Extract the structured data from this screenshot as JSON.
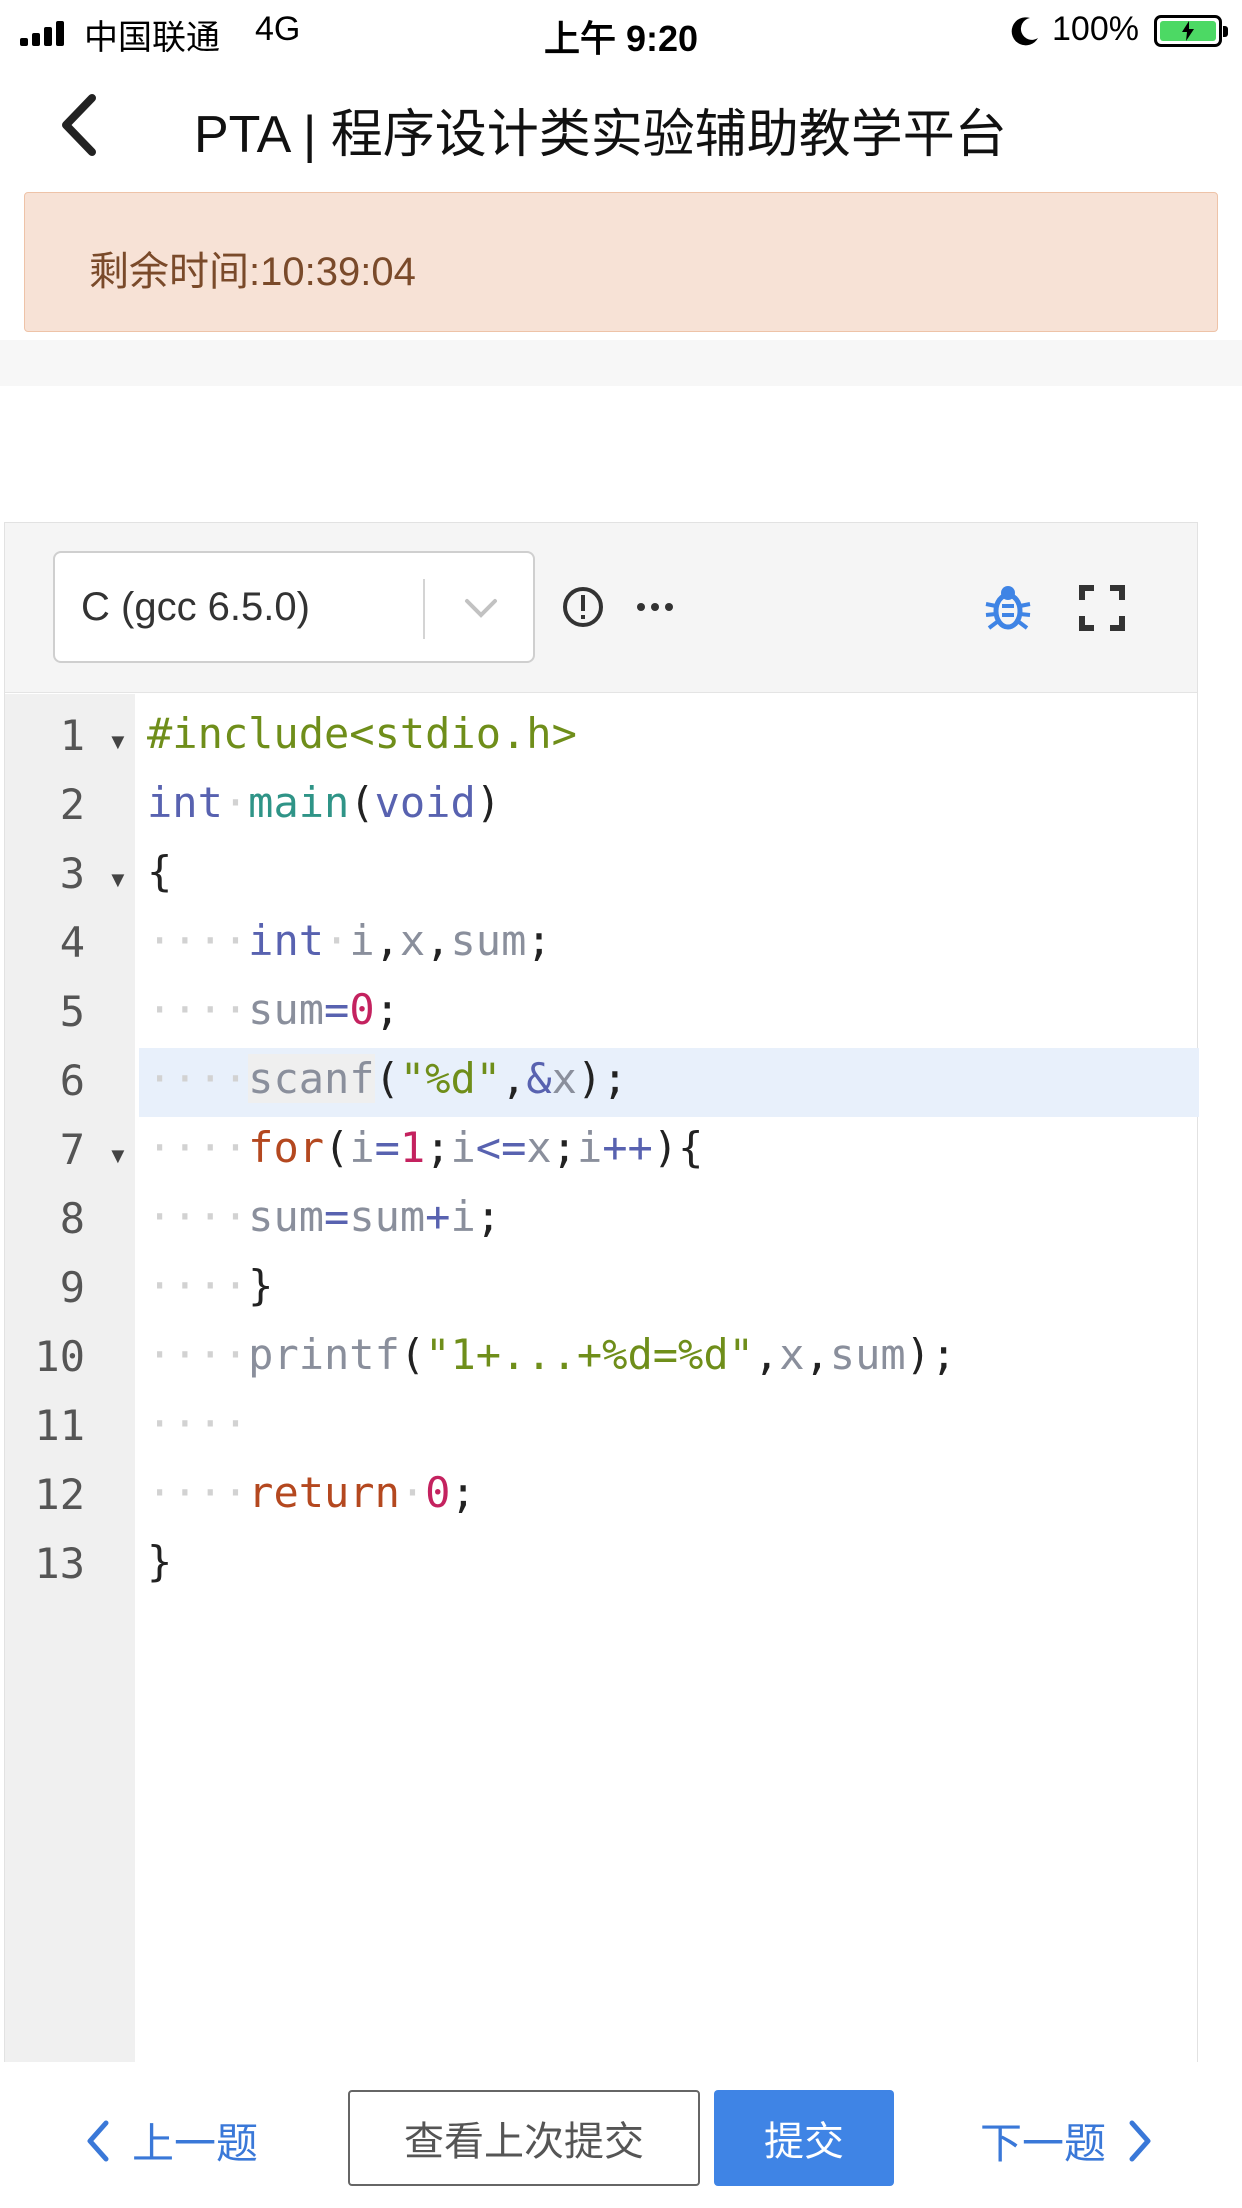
{
  "status_bar": {
    "carrier": "中国联通",
    "network": "4G",
    "time": "上午 9:20",
    "battery": "100%",
    "icons": [
      "signal-icon",
      "moon-icon",
      "battery-icon"
    ]
  },
  "nav": {
    "title": "PTA | 程序设计类实验辅助教学平台",
    "back_icon": "chevron-left-icon"
  },
  "banner": {
    "text": "剩余时间:10:39:04"
  },
  "editor": {
    "language": "C (gcc 6.5.0)",
    "toolbar_icons": [
      "info-icon",
      "more-icon",
      "bug-icon",
      "fullscreen-icon"
    ],
    "colors": {
      "accent": "#3f84e5",
      "highlight": "#e8f0fb"
    },
    "active_line": 6,
    "lines": [
      {
        "n": "1",
        "fold": "▼"
      },
      {
        "n": "2",
        "fold": ""
      },
      {
        "n": "3",
        "fold": "▼"
      },
      {
        "n": "4",
        "fold": ""
      },
      {
        "n": "5",
        "fold": ""
      },
      {
        "n": "6",
        "fold": ""
      },
      {
        "n": "7",
        "fold": "▼"
      },
      {
        "n": "8",
        "fold": ""
      },
      {
        "n": "9",
        "fold": ""
      },
      {
        "n": "10",
        "fold": ""
      },
      {
        "n": "11",
        "fold": ""
      },
      {
        "n": "12",
        "fold": ""
      },
      {
        "n": "13",
        "fold": ""
      }
    ],
    "code": [
      "#include<stdio.h>",
      "int main(void)",
      "{",
      "    int i,x,sum;",
      "    sum=0;",
      "    scanf(\"%d\",&x);",
      "    for(i=1;i<=x;i++){",
      "    sum=sum+i;",
      "    }",
      "    printf(\"1+...+%d=%d\",x,sum);",
      "    ",
      "    return 0;",
      "}"
    ]
  },
  "bottom": {
    "prev": "上一题",
    "view_last": "查看上次提交",
    "submit": "提交",
    "next": "下一题"
  }
}
